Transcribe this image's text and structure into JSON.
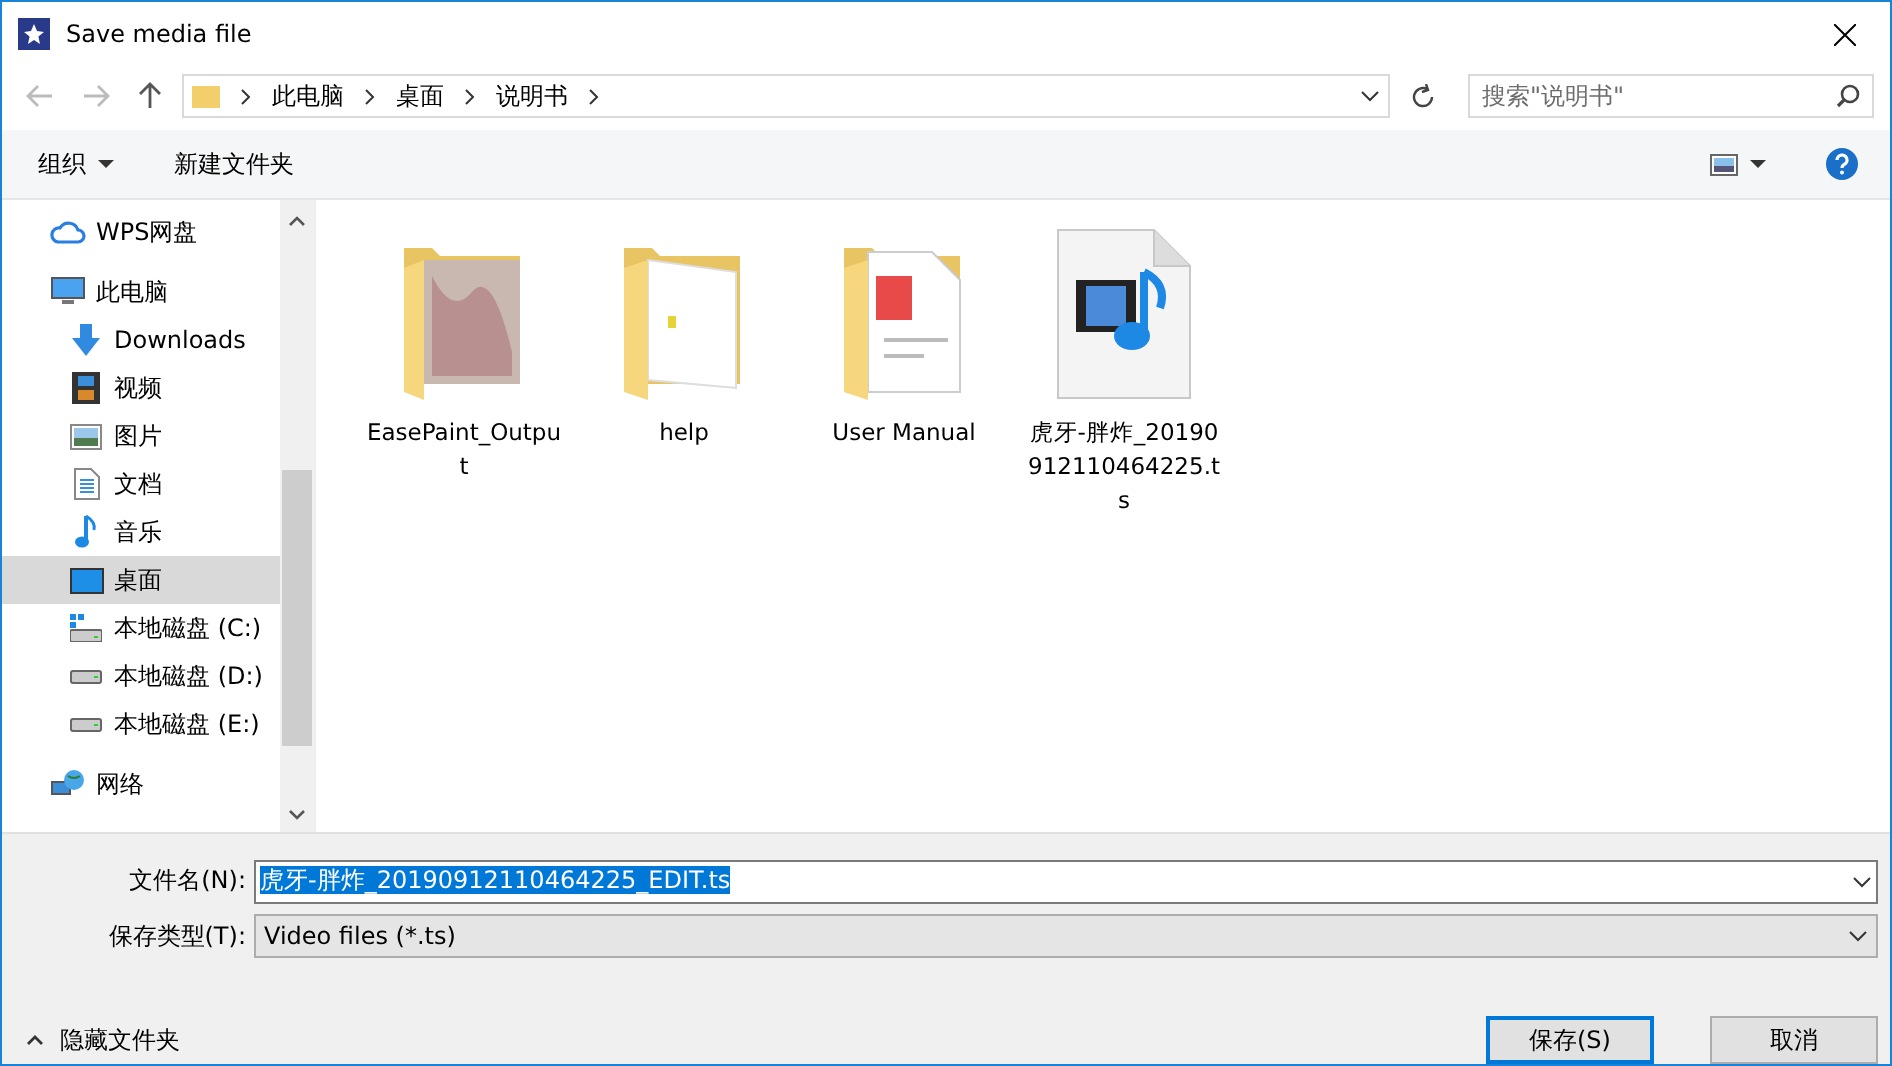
{
  "window": {
    "title": "Save media file"
  },
  "address": {
    "crumbs": [
      "此电脑",
      "桌面",
      "说明书"
    ]
  },
  "search": {
    "placeholder": "搜索\"说明书\""
  },
  "toolbar": {
    "organize": "组织",
    "new_folder": "新建文件夹"
  },
  "sidebar": {
    "items": [
      {
        "label": "WPS网盘",
        "kind": "cloud",
        "selected": false
      },
      {
        "label": "此电脑",
        "kind": "computer",
        "selected": false,
        "children": [
          {
            "label": "Downloads",
            "kind": "downloads",
            "selected": false
          },
          {
            "label": "视频",
            "kind": "video",
            "selected": false
          },
          {
            "label": "图片",
            "kind": "pictures",
            "selected": false
          },
          {
            "label": "文档",
            "kind": "documents",
            "selected": false
          },
          {
            "label": "音乐",
            "kind": "music",
            "selected": false
          },
          {
            "label": "桌面",
            "kind": "desktop",
            "selected": true
          },
          {
            "label": "本地磁盘 (C:)",
            "kind": "system-drive",
            "selected": false
          },
          {
            "label": "本地磁盘 (D:)",
            "kind": "drive",
            "selected": false
          },
          {
            "label": "本地磁盘 (E:)",
            "kind": "drive",
            "selected": false
          }
        ]
      },
      {
        "label": "网络",
        "kind": "network",
        "selected": false
      }
    ]
  },
  "files": [
    {
      "name": "EasePaint_Output",
      "kind": "photo-folder"
    },
    {
      "name": "help",
      "kind": "folder"
    },
    {
      "name": "User Manual",
      "kind": "document-folder"
    },
    {
      "name": "虎牙-胖炸_20190912110464225.ts",
      "kind": "video-file"
    }
  ],
  "form": {
    "filename_label": "文件名(N):",
    "filename": "虎牙-胖炸_20190912110464225_EDIT.ts",
    "filename_selected": true,
    "type_label": "保存类型(T):",
    "type": "Video files (*.ts)"
  },
  "hide_folders": "隐藏文件夹",
  "buttons": [
    {
      "label": "保存(S)",
      "default": true
    },
    {
      "label": "取消",
      "default": false
    }
  ]
}
